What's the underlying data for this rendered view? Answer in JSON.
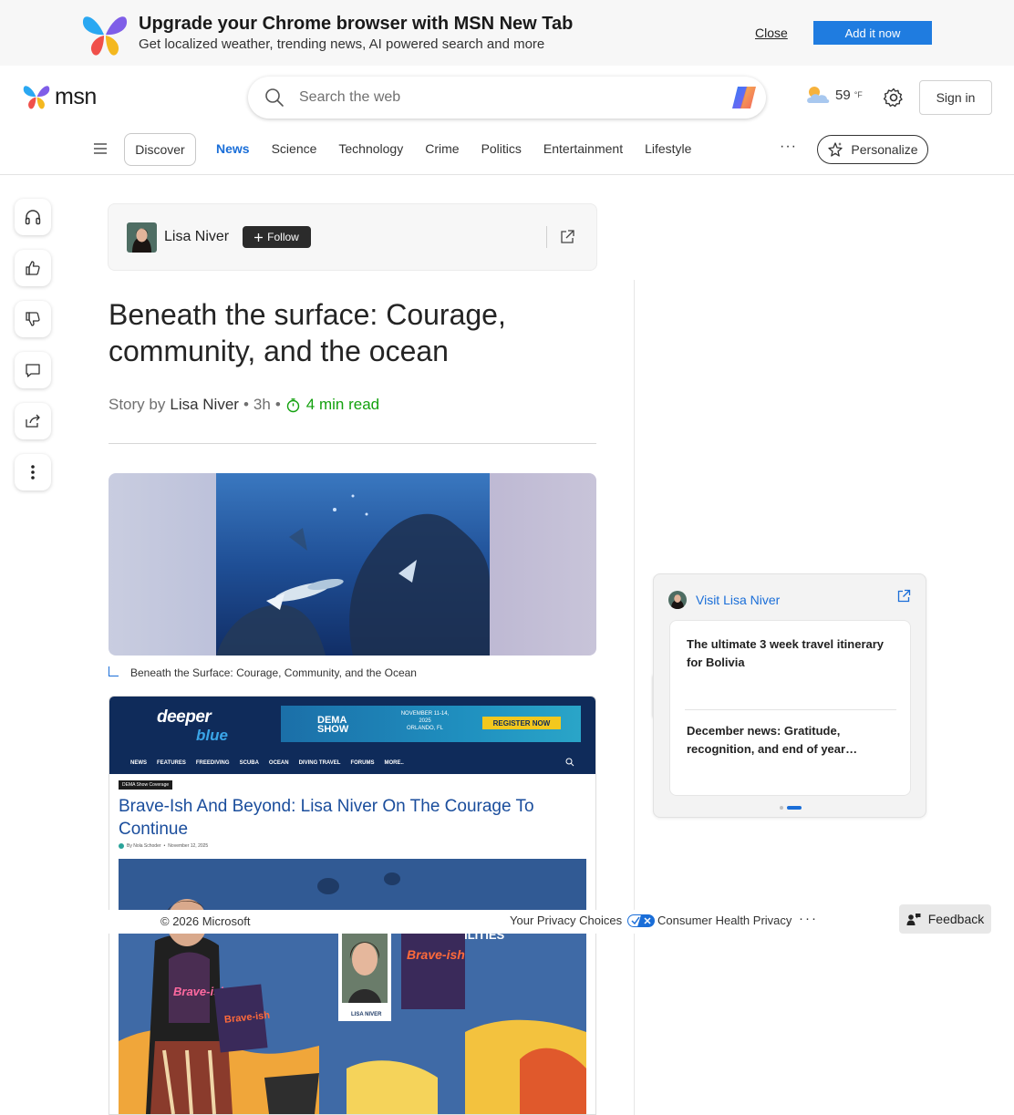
{
  "promo": {
    "title": "Upgrade your Chrome browser with MSN New Tab",
    "subtitle": "Get localized weather, trending news, AI powered search and more",
    "close_label": "Close",
    "add_label": "Add it now"
  },
  "header": {
    "brand": "msn",
    "search_placeholder": "Search the web",
    "weather_temp": "59",
    "weather_unit": "°F",
    "signin_label": "Sign in"
  },
  "nav": {
    "discover": "Discover",
    "tabs": [
      "News",
      "Science",
      "Technology",
      "Crime",
      "Politics",
      "Entertainment",
      "Lifestyle"
    ],
    "active_tab": "News",
    "more": "···",
    "personalize": "Personalize"
  },
  "author": {
    "name": "Lisa Niver",
    "follow_label": "Follow"
  },
  "article": {
    "headline": "Beneath the surface: Courage, community, and the ocean",
    "story_by": "Story by",
    "author": "Lisa Niver",
    "age": "3h",
    "read_time": "4 min read",
    "image_caption": "Beneath the Surface: Courage, Community, and the Ocean"
  },
  "embed": {
    "logo_top": "deeper",
    "logo_bottom": "blue",
    "ad_brand_1": "DEMA",
    "ad_brand_2": "SHOW",
    "ad_dates": "NOVEMBER 11-14, 2025",
    "ad_city": "ORLANDO, FL",
    "ad_register": "REGISTER NOW",
    "menu": [
      "NEWS",
      "FEATURES",
      "FREEDIVING",
      "SCUBA",
      "OCEAN",
      "DIVING TRAVEL",
      "FORUMS",
      "MORE.."
    ],
    "tag": "DEMA Show Coverage",
    "title": "Brave-Ish And Beyond: Lisa Niver On The Courage To Continue",
    "meta_author": "By Nola Schoder",
    "meta_date": "November 12, 2025",
    "photo_banner": "POSSIBILITIES",
    "book_title": "Brave-ish",
    "book_author": "LISA NIVER"
  },
  "sidebar": {
    "visit_label": "Visit Lisa Niver",
    "items": [
      "The ultimate 3 week travel itinerary for Bolivia",
      "December news: Gratitude, recognition, and end of year…"
    ]
  },
  "footer": {
    "copyright": "© 2026 Microsoft",
    "privacy": "Your Privacy Choices",
    "health": "Consumer Health Privacy",
    "more": "···",
    "feedback": "Feedback"
  },
  "colors": {
    "accent": "#1a6ed8",
    "promo_button": "#1f7ce0",
    "read_time": "#13a10e",
    "embed_header": "#0f2b5a",
    "embed_title": "#1a4d9c"
  }
}
